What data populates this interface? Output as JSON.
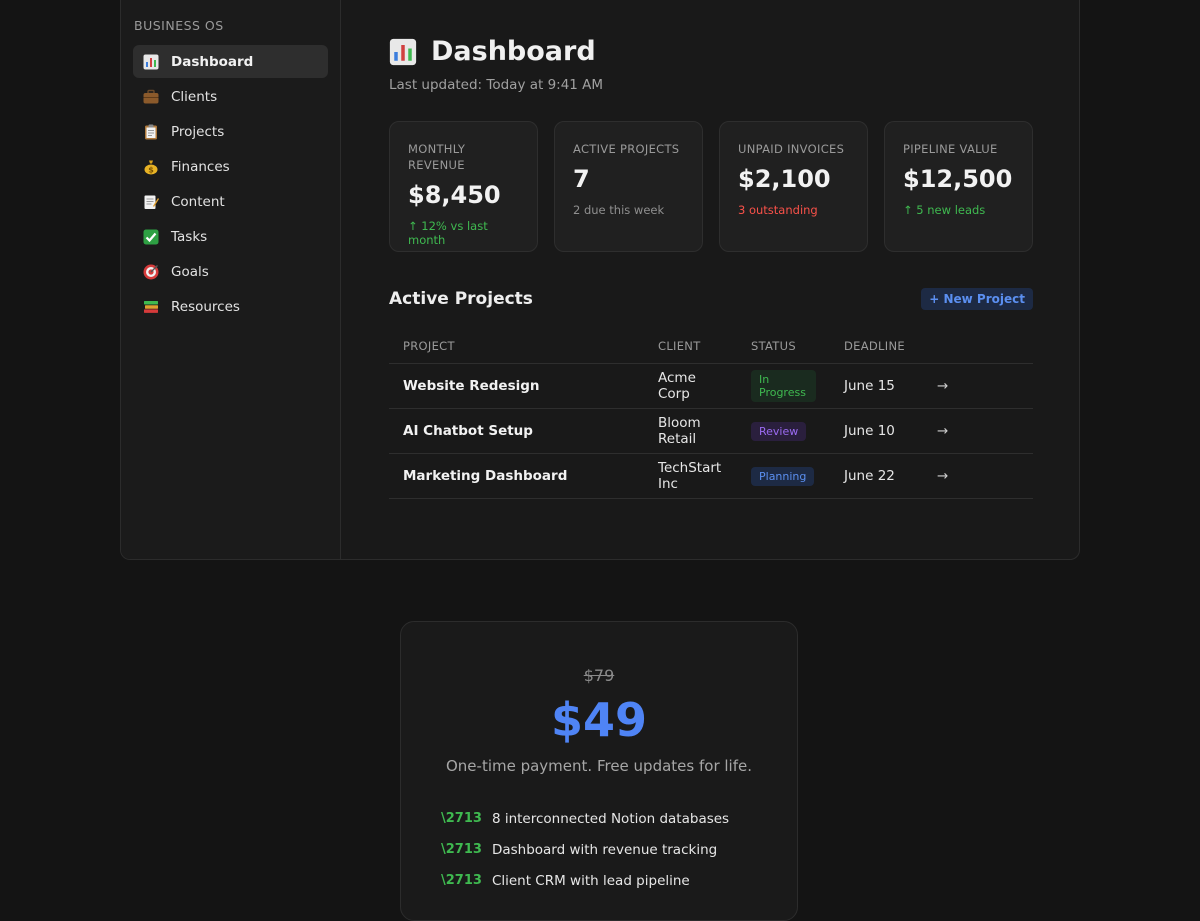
{
  "sidebar": {
    "brand": "BUSINESS OS",
    "items": [
      {
        "label": "Dashboard",
        "icon": "bar-chart-icon",
        "active": true
      },
      {
        "label": "Clients",
        "icon": "briefcase-icon",
        "active": false
      },
      {
        "label": "Projects",
        "icon": "clipboard-icon",
        "active": false
      },
      {
        "label": "Finances",
        "icon": "money-bag-icon",
        "active": false
      },
      {
        "label": "Content",
        "icon": "memo-icon",
        "active": false
      },
      {
        "label": "Tasks",
        "icon": "check-box-icon",
        "active": false
      },
      {
        "label": "Goals",
        "icon": "target-icon",
        "active": false
      },
      {
        "label": "Resources",
        "icon": "books-icon",
        "active": false
      }
    ]
  },
  "header": {
    "title": "Dashboard",
    "icon": "bar-chart-icon",
    "subtitle": "Last updated: Today at 9:41 AM"
  },
  "stats": [
    {
      "label": "MONTHLY REVENUE",
      "value": "$8,450",
      "note": "↑ 12% vs last month",
      "tone": "green"
    },
    {
      "label": "ACTIVE PROJECTS",
      "value": "7",
      "note": "2 due this week",
      "tone": "muted"
    },
    {
      "label": "UNPAID INVOICES",
      "value": "$2,100",
      "note": "3 outstanding",
      "tone": "red"
    },
    {
      "label": "PIPELINE VALUE",
      "value": "$12,500",
      "note": "↑ 5 new leads",
      "tone": "green"
    }
  ],
  "projects": {
    "title": "Active Projects",
    "new_button": "+ New Project",
    "columns": [
      "PROJECT",
      "CLIENT",
      "STATUS",
      "DEADLINE"
    ],
    "rows": [
      {
        "project": "Website Redesign",
        "client": "Acme Corp",
        "status": "In Progress",
        "status_tone": "progress",
        "deadline": "June 15",
        "action": "→"
      },
      {
        "project": "AI Chatbot Setup",
        "client": "Bloom Retail",
        "status": "Review",
        "status_tone": "review",
        "deadline": "June 10",
        "action": "→"
      },
      {
        "project": "Marketing Dashboard",
        "client": "TechStart Inc",
        "status": "Planning",
        "status_tone": "planning",
        "deadline": "June 22",
        "action": "→"
      }
    ]
  },
  "pricing": {
    "old_price": "$79",
    "price": "$49",
    "note": "One-time payment. Free updates for life.",
    "check_glyph": "\\2713",
    "features": [
      "8 interconnected Notion databases",
      "Dashboard with revenue tracking",
      "Client CRM with lead pipeline"
    ]
  },
  "colors": {
    "background": "#141414",
    "accent_blue": "#4f84f5",
    "positive_green": "#3fb950",
    "negative_red": "#f85149",
    "review_purple": "#9b6bf2"
  }
}
